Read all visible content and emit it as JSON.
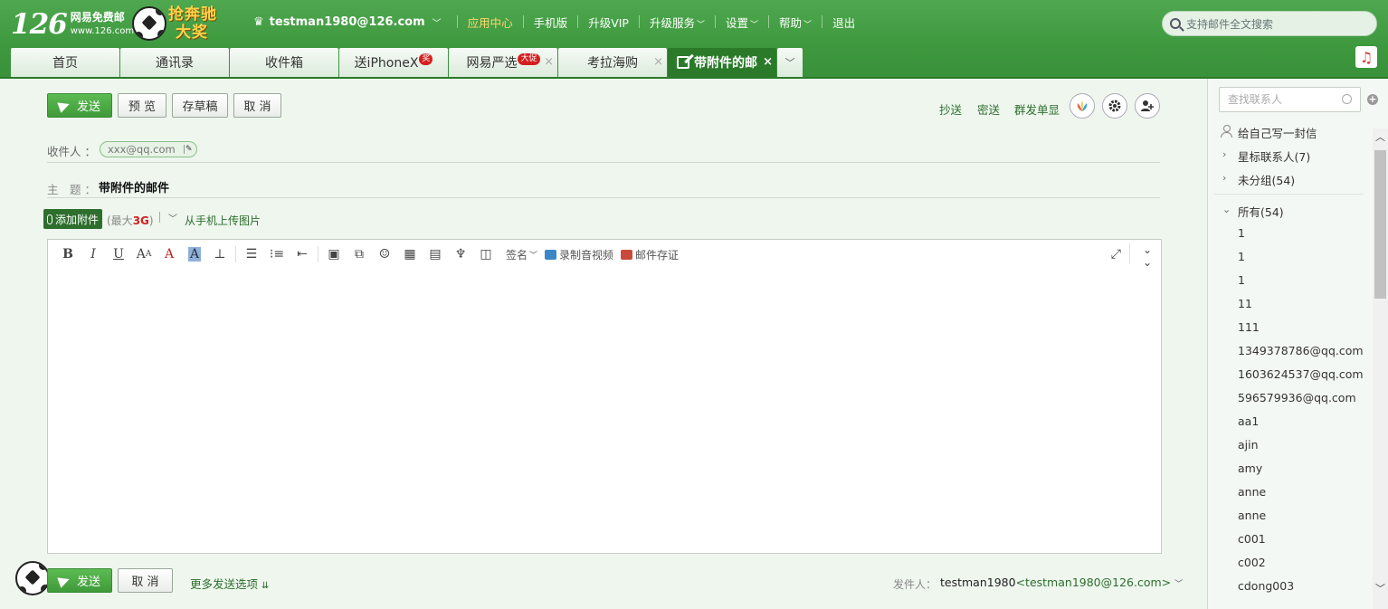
{
  "header": {
    "logo_number": "126",
    "logo_title": "网易免费邮",
    "logo_url": "www.126.com",
    "promo_line1": "抢奔驰",
    "promo_line2": "大奖",
    "user": "testman1980@126.com",
    "nav": [
      "应用中心",
      "手机版",
      "升级VIP",
      "升级服务",
      "设置",
      "帮助",
      "退出"
    ],
    "search_placeholder": "支持邮件全文搜索"
  },
  "tabs": [
    {
      "label": "首页"
    },
    {
      "label": "通讯录"
    },
    {
      "label": "收件箱"
    },
    {
      "label": "送iPhoneX",
      "badge": "奖"
    },
    {
      "label": "网易严选",
      "badge": "大促"
    },
    {
      "label": "考拉海购"
    },
    {
      "label": "带附件的邮"
    }
  ],
  "compose": {
    "send": "发送",
    "preview": "预 览",
    "draft": "存草稿",
    "cancel": "取 消",
    "cc": "抄送",
    "bcc": "密送",
    "separate": "群发单显",
    "to_label": "收件人 ：",
    "to_chip": "xxx@qq.com",
    "subject_label": "主　题 ：",
    "subject": "带附件的邮件",
    "add_attachment": "添加附件",
    "max_size_prefix": "(最大",
    "max_size": "3G",
    "max_size_suffix": ")",
    "upload_phone": "从手机上传图片",
    "signature": "签名",
    "record_av": "录制音视频",
    "mail_evidence": "邮件存证",
    "more_options": "更多发送选项",
    "sender_label": "发件人：",
    "sender_name": "testman1980",
    "sender_email": "<testman1980@126.com>"
  },
  "sidebar": {
    "search_placeholder": "查找联系人",
    "write_self": "给自己写一封信",
    "starred": "星标联系人(7)",
    "ungrouped": "未分组(54)",
    "all": "所有(54)",
    "contacts": [
      "1",
      "1",
      "1",
      "11",
      "111",
      "1349378786@qq.com",
      "1603624537@qq.com",
      "596579936@qq.com",
      "aa1",
      "ajin",
      "amy",
      "anne",
      "anne",
      "c001",
      "c002",
      "cdong003"
    ]
  },
  "colors": {
    "header_green": "#3e983e",
    "active_tab": "#2a7a2a",
    "link_green": "#2d6e2d",
    "badge_red": "#d41f1f"
  }
}
